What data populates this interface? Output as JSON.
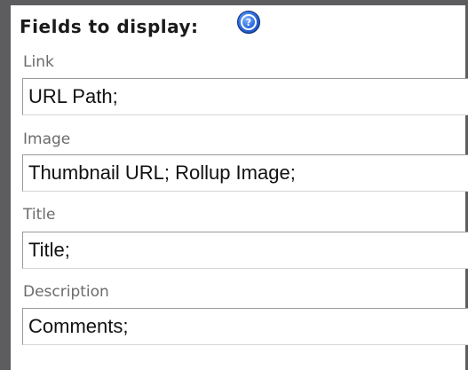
{
  "section": {
    "title": "Fields to display:",
    "help_icon": "help-question-icon"
  },
  "fields": [
    {
      "label": "Link",
      "value": "URL Path;"
    },
    {
      "label": "Image",
      "value": "Thumbnail URL; Rollup Image;"
    },
    {
      "label": "Title",
      "value": "Title;"
    },
    {
      "label": "Description",
      "value": "Comments;"
    }
  ],
  "colors": {
    "frame": "#5d5d60",
    "label": "#6b6b6b",
    "title": "#1a1a1a",
    "help_icon": "#2f6fe0"
  }
}
